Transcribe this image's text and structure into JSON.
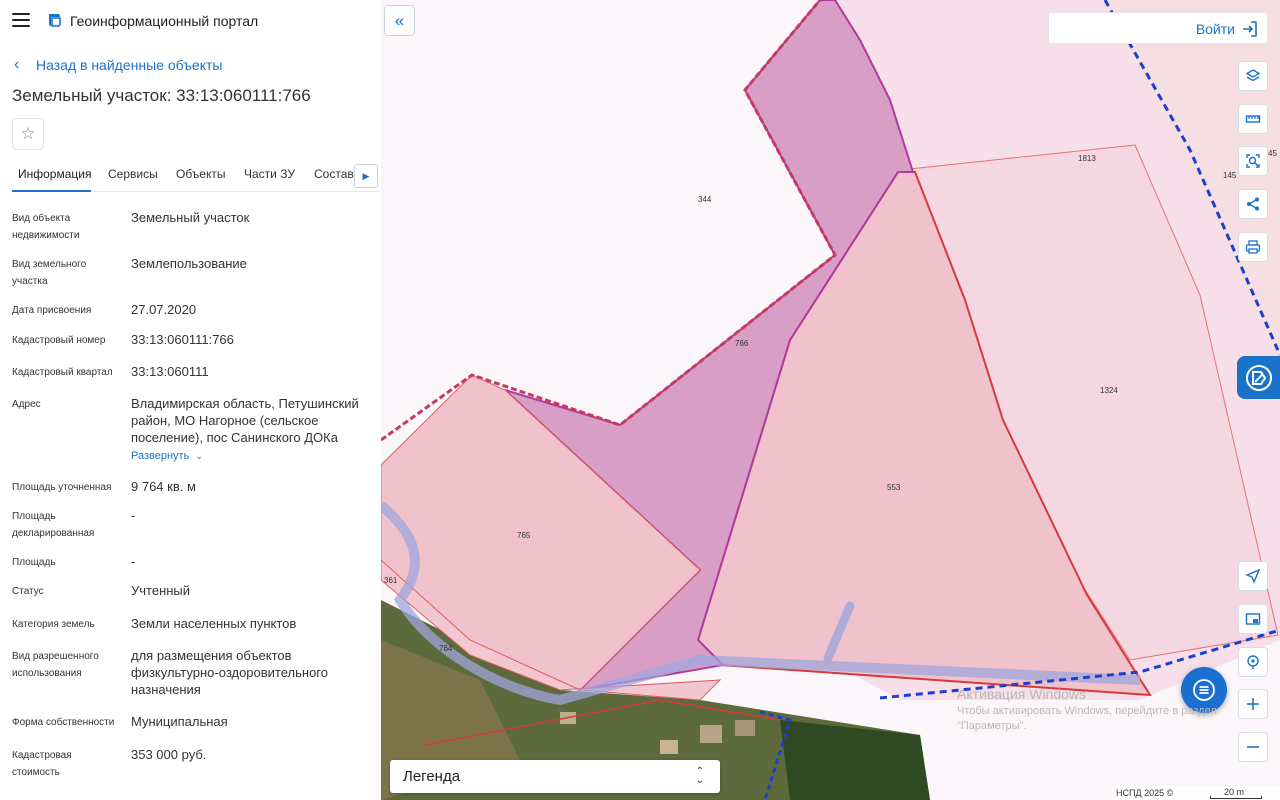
{
  "header": {
    "title": "Геоинформационный портал"
  },
  "nav": {
    "back_label": "Назад в найденные объекты",
    "collapse_glyph": "«"
  },
  "object": {
    "title": "Земельный участок: 33:13:060111:766"
  },
  "tabs": [
    {
      "label": "Информация",
      "active": true
    },
    {
      "label": "Сервисы"
    },
    {
      "label": "Объекты"
    },
    {
      "label": "Части ЗУ"
    },
    {
      "label": "Состав"
    }
  ],
  "info": {
    "rows": [
      {
        "label": "Вид объекта недвижимости",
        "value": "Земельный участок"
      },
      {
        "label": "Вид земельного участка",
        "value": "Землепользование"
      },
      {
        "label": "Дата присвоения",
        "value": "27.07.2020"
      },
      {
        "label": "Кадастровый номер",
        "value": "33:13:060111:766"
      },
      {
        "label": "Кадастровый квартал",
        "value": "33:13:060111"
      },
      {
        "label": "Адрес",
        "value": "Владимирская область, Петушинский район, МО Нагорное (сельское поселение), пос Санинского ДОКа"
      },
      {
        "label": "Площадь уточненная",
        "value": "9 764 кв. м"
      },
      {
        "label": "Площадь декларированная",
        "value": "-"
      },
      {
        "label": "Площадь",
        "value": "-"
      },
      {
        "label": "Статус",
        "value": "Учтенный"
      },
      {
        "label": "Категория земель",
        "value": "Земли населенных пунктов"
      },
      {
        "label": "Вид разрешенного использования",
        "value": "для размещения объектов физкультурно-оздоровительного назначения"
      },
      {
        "label": "Форма собственности",
        "value": "Муниципальная"
      },
      {
        "label": "Кадастровая стоимость",
        "value": "353 000 руб."
      }
    ],
    "expand_label": "Развернуть"
  },
  "map": {
    "parcel_labels": {
      "p344": "344",
      "p766": "766",
      "p1813": "1813",
      "p1324": "1324",
      "p553": "553",
      "p765": "765",
      "p361": "361",
      "p764": "764",
      "p145": "145",
      "p45": "45"
    },
    "colors": {
      "accent": "#1a73c9",
      "parcel_pink": "#f0c3cc",
      "parcel_purple": "#d99ec6",
      "boundary_blue": "#1d3fd0"
    }
  },
  "login": {
    "label": "Войти"
  },
  "toolbar": [
    "layers-icon",
    "ruler-icon",
    "select-area-icon",
    "share-icon",
    "print-icon"
  ],
  "controls": [
    "locate-icon",
    "minimap-icon",
    "geolocation-icon",
    "zoom-in-icon",
    "zoom-out-icon"
  ],
  "legend": {
    "label": "Легенда"
  },
  "watermark": {
    "title": "Активация Windows",
    "text": "Чтобы активировать Windows, перейдите в раздел \"Параметры\"."
  },
  "attribution": {
    "text": "НСПД 2025 ©",
    "scale": "20 m"
  }
}
